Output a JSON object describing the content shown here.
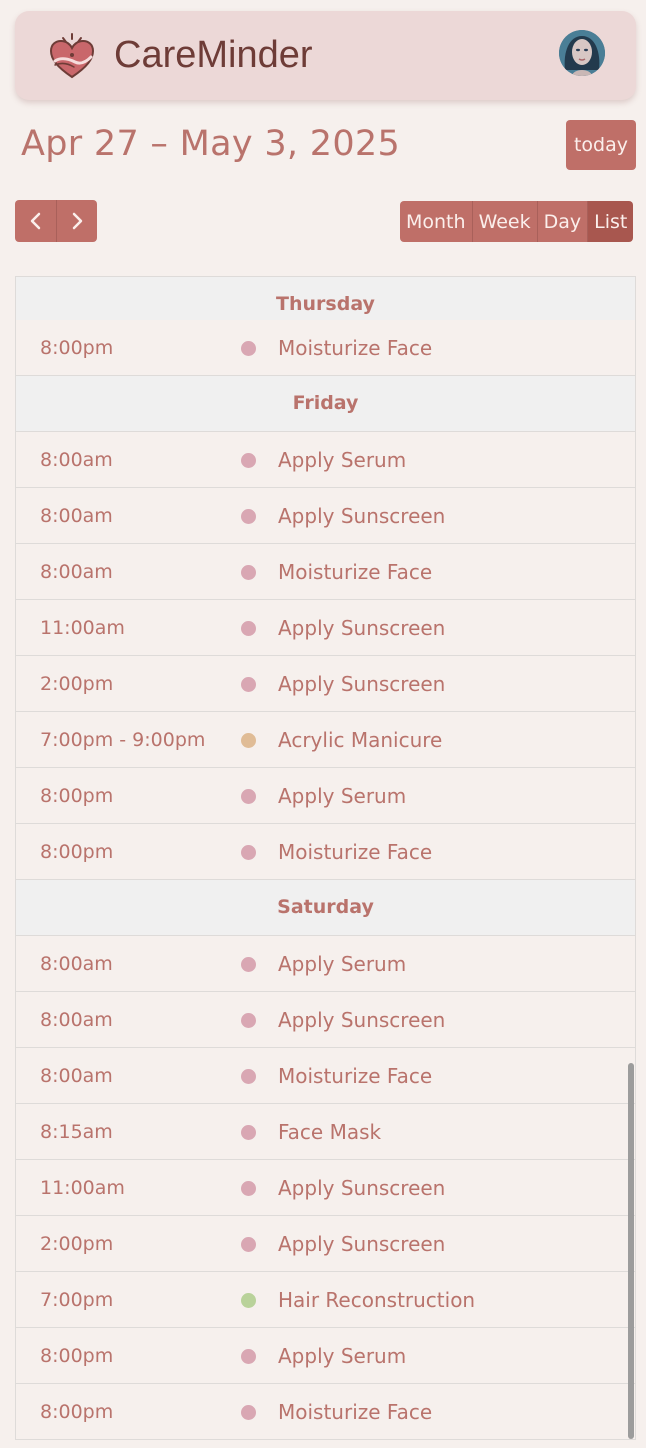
{
  "app": {
    "title": "CareMinder",
    "logo": "heart-hands-icon",
    "avatar": "user-avatar"
  },
  "toolbar": {
    "range_title": "Apr 27 – May 3, 2025",
    "today_label": "today",
    "prev_icon": "chevron-left-icon",
    "next_icon": "chevron-right-icon",
    "views": [
      "Month",
      "Week",
      "Day",
      "List"
    ],
    "active_view": "List"
  },
  "colors": {
    "accent": "#bf6f68",
    "accent_active": "#a8574f",
    "text": "#b9736c",
    "skincare_dot": "#d9a7b3",
    "nails_dot": "#e0bc96",
    "hair_dot": "#b9d29a"
  },
  "list": {
    "thursday_header": "Thursday",
    "thursday": [
      {
        "time": "8:00pm",
        "title": "Moisturize Face",
        "color": "#d9a7b3"
      }
    ],
    "friday_header": "Friday",
    "friday": [
      {
        "time": "8:00am",
        "title": "Apply Serum",
        "color": "#d9a7b3"
      },
      {
        "time": "8:00am",
        "title": "Apply Sunscreen",
        "color": "#d9a7b3"
      },
      {
        "time": "8:00am",
        "title": "Moisturize Face",
        "color": "#d9a7b3"
      },
      {
        "time": "11:00am",
        "title": "Apply Sunscreen",
        "color": "#d9a7b3"
      },
      {
        "time": "2:00pm",
        "title": "Apply Sunscreen",
        "color": "#d9a7b3"
      },
      {
        "time": "7:00pm - 9:00pm",
        "title": "Acrylic Manicure",
        "color": "#e0bc96"
      },
      {
        "time": "8:00pm",
        "title": "Apply Serum",
        "color": "#d9a7b3"
      },
      {
        "time": "8:00pm",
        "title": "Moisturize Face",
        "color": "#d9a7b3"
      }
    ],
    "saturday_header": "Saturday",
    "saturday": [
      {
        "time": "8:00am",
        "title": "Apply Serum",
        "color": "#d9a7b3"
      },
      {
        "time": "8:00am",
        "title": "Apply Sunscreen",
        "color": "#d9a7b3"
      },
      {
        "time": "8:00am",
        "title": "Moisturize Face",
        "color": "#d9a7b3"
      },
      {
        "time": "8:15am",
        "title": "Face Mask",
        "color": "#d9a7b3"
      },
      {
        "time": "11:00am",
        "title": "Apply Sunscreen",
        "color": "#d9a7b3"
      },
      {
        "time": "2:00pm",
        "title": "Apply Sunscreen",
        "color": "#d9a7b3"
      },
      {
        "time": "7:00pm",
        "title": "Hair Reconstruction",
        "color": "#b9d29a"
      },
      {
        "time": "8:00pm",
        "title": "Apply Serum",
        "color": "#d9a7b3"
      },
      {
        "time": "8:00pm",
        "title": "Moisturize Face",
        "color": "#d9a7b3"
      }
    ]
  }
}
